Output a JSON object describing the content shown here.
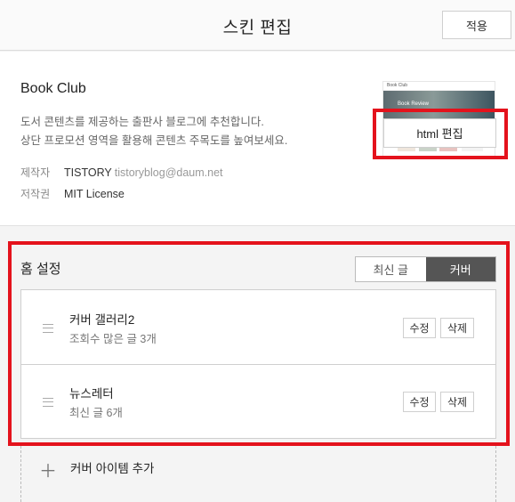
{
  "header": {
    "title": "스킨 편집",
    "apply_label": "적용"
  },
  "skin": {
    "name": "Book Club",
    "desc_line1": "도서 콘텐츠를 제공하는 출판사 블로그에 추천합니다.",
    "desc_line2": "상단 프로모션 영역을 활용해 콘텐츠 주목도를 높여보세요.",
    "maker_label": "제작자",
    "maker_value": "TISTORY",
    "maker_email": "tistoryblog@daum.net",
    "license_label": "저작권",
    "license_value": "MIT License",
    "html_edit_label": "html 편집",
    "thumb_brand": "Book Club",
    "thumb_banner": "Book Review"
  },
  "home": {
    "title": "홈 설정",
    "tab_latest": "최신 글",
    "tab_cover": "커버",
    "active_tab": "커버",
    "items": [
      {
        "name": "커버 갤러리2",
        "sub": "조회수 많은 글 3개",
        "edit": "수정",
        "delete": "삭제"
      },
      {
        "name": "뉴스레터",
        "sub": "최신 글 6개",
        "edit": "수정",
        "delete": "삭제"
      }
    ],
    "add_icon": "plus-icon",
    "add_label": "커버 아이템 추가"
  },
  "colors": {
    "highlight": "#e4121c",
    "active_tab": "#555555"
  }
}
